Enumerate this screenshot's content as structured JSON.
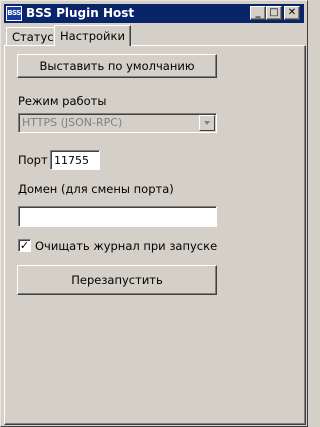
{
  "window": {
    "title": "BSS Plugin Host",
    "icon_label": "BSS",
    "controls": {
      "minimize": "_",
      "maximize": "□",
      "close": "✕"
    }
  },
  "tabs": [
    {
      "label": "Статус",
      "active": false
    },
    {
      "label": "Настройки",
      "active": true
    }
  ],
  "settings": {
    "reset_button": "Выставить по умолчанию",
    "mode_label": "Режим работы",
    "mode_value": "HTTPS (JSON-RPC)",
    "port_label": "Порт",
    "port_value": "11755",
    "domain_label": "Домен (для смены порта)",
    "domain_value": "",
    "clear_log_label": "Очищать журнал при запуске",
    "clear_log_checked": true,
    "restart_button": "Перезапустить"
  }
}
